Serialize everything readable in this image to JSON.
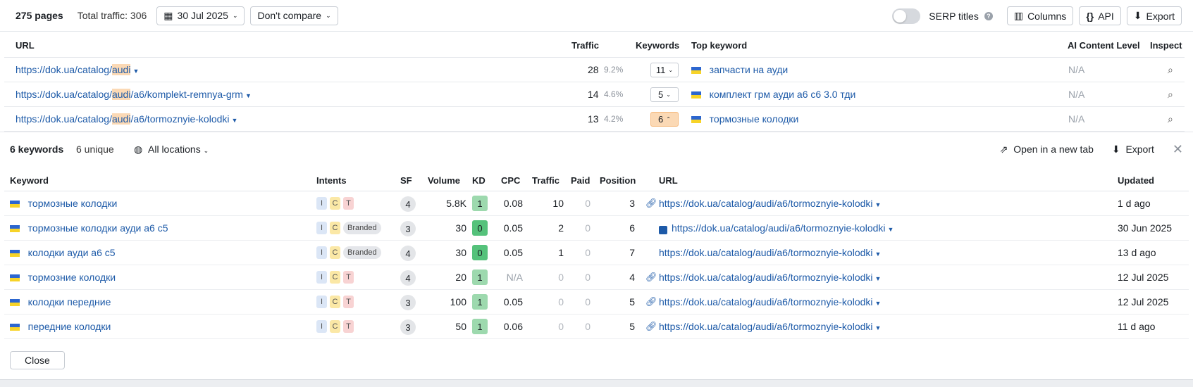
{
  "toolbar": {
    "pages": "275 pages",
    "total_traffic": "Total traffic: 306",
    "date": "30 Jul 2025",
    "compare": "Don't compare",
    "serp_titles": "SERP titles",
    "columns": "Columns",
    "api": "API",
    "export": "Export"
  },
  "main_table": {
    "headers": [
      "URL",
      "Traffic",
      "Keywords",
      "Top keyword",
      "AI Content Level",
      "Inspect"
    ],
    "rows": [
      {
        "url_pre": "https://dok.ua/catalog/",
        "url_hl": "audi",
        "url_post": "",
        "traffic": "28",
        "share": "9.2%",
        "keywords": "11",
        "top_keyword": "запчасти на ауди",
        "ai": "N/A"
      },
      {
        "url_pre": "https://dok.ua/catalog/",
        "url_hl": "audi",
        "url_post": "/a6/komplekt-remnya-grm",
        "traffic": "14",
        "share": "4.6%",
        "keywords": "5",
        "top_keyword": "комплект грм ауди а6 с6 3.0 тди",
        "ai": "N/A"
      },
      {
        "url_pre": "https://dok.ua/catalog/",
        "url_hl": "audi",
        "url_post": "/a6/tormoznyie-kolodki",
        "traffic": "13",
        "share": "4.2%",
        "keywords": "6",
        "top_keyword": "тормозные колодки",
        "ai": "N/A"
      }
    ]
  },
  "panel": {
    "keywords_count": "6 keywords",
    "unique": "6 unique",
    "locations": "All locations",
    "open_new_tab": "Open in a new tab",
    "export": "Export",
    "close": "Close",
    "headers": [
      "Keyword",
      "Intents",
      "SF",
      "Volume",
      "KD",
      "CPC",
      "Traffic",
      "Paid",
      "Position",
      "URL",
      "Updated"
    ],
    "rows": [
      {
        "keyword": "тормозные колодки",
        "intents": [
          "I",
          "C",
          "T"
        ],
        "sf": "4",
        "volume": "5.8K",
        "kd": "1",
        "cpc": "0.08",
        "traffic": "10",
        "paid": "0",
        "position": "3",
        "url": "https://dok.ua/catalog/audi/a6/tormoznyie-kolodki",
        "updated": "1 d ago",
        "url_icon": "link-icon"
      },
      {
        "keyword": "тормозные колодки ауди а6 с5",
        "intents": [
          "I",
          "C",
          "Branded"
        ],
        "sf": "3",
        "volume": "30",
        "kd": "0",
        "cpc": "0.05",
        "traffic": "2",
        "paid": "0",
        "position": "6",
        "url": "https://dok.ua/catalog/audi/a6/tormoznyie-kolodki",
        "updated": "30 Jun 2025",
        "url_icon": "image-icon"
      },
      {
        "keyword": "колодки ауди а6 с5",
        "intents": [
          "I",
          "C",
          "Branded"
        ],
        "sf": "4",
        "volume": "30",
        "kd": "0",
        "cpc": "0.05",
        "traffic": "1",
        "paid": "0",
        "position": "7",
        "url": "https://dok.ua/catalog/audi/a6/tormoznyie-kolodki",
        "updated": "13 d ago",
        "url_icon": ""
      },
      {
        "keyword": "тормозние колодки",
        "intents": [
          "I",
          "C",
          "T"
        ],
        "sf": "4",
        "volume": "20",
        "kd": "1",
        "cpc": "N/A",
        "traffic": "0",
        "paid": "0",
        "position": "4",
        "url": "https://dok.ua/catalog/audi/a6/tormoznyie-kolodki",
        "updated": "12 Jul 2025",
        "url_icon": "link-icon"
      },
      {
        "keyword": "колодки передние",
        "intents": [
          "I",
          "C",
          "T"
        ],
        "sf": "3",
        "volume": "100",
        "kd": "1",
        "cpc": "0.05",
        "traffic": "0",
        "paid": "0",
        "position": "5",
        "url": "https://dok.ua/catalog/audi/a6/tormoznyie-kolodki",
        "updated": "12 Jul 2025",
        "url_icon": "link-icon"
      },
      {
        "keyword": "передние колодки",
        "intents": [
          "I",
          "C",
          "T"
        ],
        "sf": "3",
        "volume": "50",
        "kd": "1",
        "cpc": "0.06",
        "traffic": "0",
        "paid": "0",
        "position": "5",
        "url": "https://dok.ua/catalog/audi/a6/tormoznyie-kolodki",
        "updated": "11 d ago",
        "url_icon": "link-icon"
      }
    ]
  }
}
